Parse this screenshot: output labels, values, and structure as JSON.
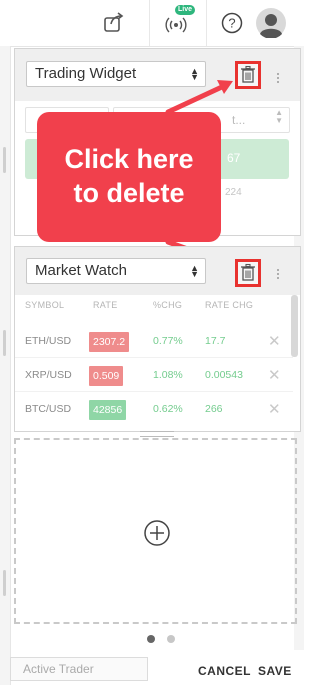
{
  "topbar": {
    "share_icon": "share-icon",
    "live_icon": "broadcast-icon",
    "live_badge": "Live",
    "help_icon": "help-icon",
    "avatar_icon": "user-avatar-icon"
  },
  "trading_widget": {
    "select_value": "Trading Widget",
    "ghost_input_hint": "t...",
    "ghost_price": "67",
    "ghost_sub": "224"
  },
  "callout": {
    "line1": "Click here",
    "line2": "to delete"
  },
  "market_watch": {
    "select_value": "Market Watch",
    "columns": [
      "SYMBOL",
      "RATE",
      "%CHG",
      "RATE CHG"
    ],
    "rows": [
      {
        "symbol": "ETH/USD",
        "rate": "2307.2",
        "rate_color": "#ef8c8c",
        "pct": "0.77%",
        "rate_chg": "17.7"
      },
      {
        "symbol": "XRP/USD",
        "rate": "0.509",
        "rate_color": "#ef8c8c",
        "pct": "1.08%",
        "rate_chg": "0.00543"
      },
      {
        "symbol": "BTC/USD",
        "rate": "42856",
        "rate_color": "#8fd6a6",
        "pct": "0.62%",
        "rate_chg": "266"
      }
    ]
  },
  "empty_slot": {
    "add_icon": "plus-circle-icon"
  },
  "pagination": {
    "pages": 2,
    "active": 1
  },
  "footer": {
    "tab_label": "Active Trader",
    "cancel_label": "CANCEL",
    "save_label": "SAVE"
  },
  "colors": {
    "callout": "#f1404c",
    "highlight": "#e8322f",
    "live": "#2eb67d"
  }
}
